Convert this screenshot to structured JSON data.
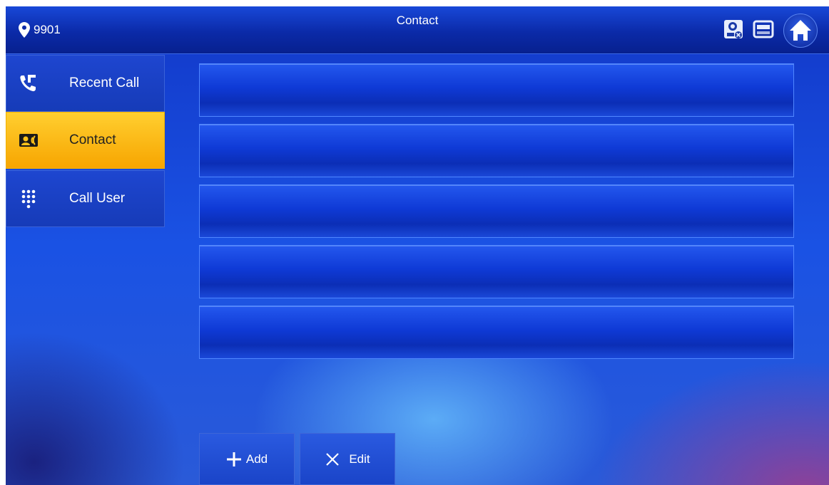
{
  "topbar": {
    "location_number": "9901",
    "title": "Contact",
    "icons": [
      "pin-icon",
      "camera-disconnected-icon",
      "monitor-icon",
      "home-icon"
    ]
  },
  "sidebar": {
    "items": [
      {
        "label": "Recent Call",
        "icon": "recent-call-icon",
        "active": false
      },
      {
        "label": "Contact",
        "icon": "contact-card-icon",
        "active": true
      },
      {
        "label": "Call User",
        "icon": "keypad-icon",
        "active": false
      }
    ]
  },
  "contact_list": {
    "rows": [
      "",
      "",
      "",
      "",
      ""
    ]
  },
  "actions": {
    "add_label": "Add",
    "edit_label": "Edit"
  },
  "colors": {
    "active_tab": "#f7a500",
    "background": "#1a52e4",
    "topbar": "#0b2aa8"
  }
}
